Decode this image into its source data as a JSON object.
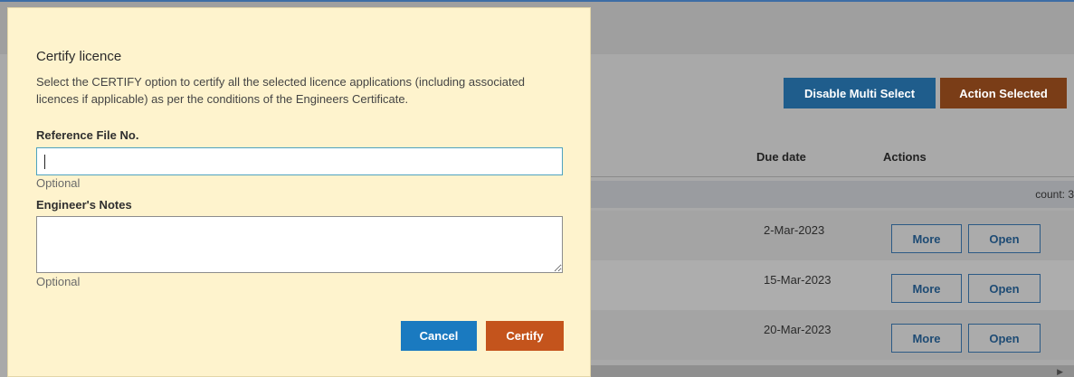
{
  "modal": {
    "title": "Certify licence",
    "description": "Select the CERTIFY option to certify all the selected licence applications (including associated licences if applicable) as per the conditions of the Engineers Certificate.",
    "reference_label": "Reference File No.",
    "reference_value": "",
    "reference_hint": "Optional",
    "notes_label": "Engineer's Notes",
    "notes_value": "",
    "notes_hint": "Optional",
    "cancel_label": "Cancel",
    "certify_label": "Certify"
  },
  "background": {
    "disable_multi_select_label": "Disable Multi Select",
    "action_selected_label": "Action Selected",
    "columns": {
      "due_date": "Due date",
      "actions": "Actions"
    },
    "count_label": "count: 3",
    "rows": [
      {
        "due_date": "2-Mar-2023",
        "more_label": "More",
        "open_label": "Open"
      },
      {
        "due_date": "15-Mar-2023",
        "more_label": "More",
        "open_label": "Open"
      },
      {
        "due_date": "20-Mar-2023",
        "more_label": "More",
        "open_label": "Open"
      }
    ]
  },
  "colors": {
    "modal_background": "#fef3cd",
    "cancel_button": "#1a7ac0",
    "certify_button": "#c4541c",
    "input_focus_border": "#4ea2bf"
  },
  "icons": {
    "resize_handle": "resize-grip-icon",
    "scroll_right": "scroll-right-arrow-icon"
  }
}
